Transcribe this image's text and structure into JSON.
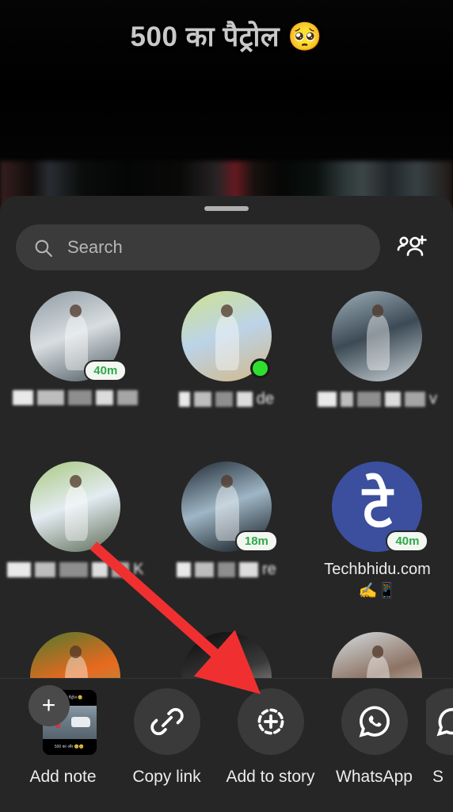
{
  "video": {
    "caption": "500 का पैट्रोल 🥺",
    "caption_color": "#c9c9c9"
  },
  "sheet": {
    "handle_name": "drag-handle"
  },
  "search": {
    "placeholder": "Search",
    "value": "",
    "icon": "search-icon",
    "add_people_icon": "add-people-icon"
  },
  "contacts": [
    {
      "name": "",
      "name_redacted": true,
      "redacted_blocks": [
        26,
        34,
        30,
        22,
        26
      ],
      "avatar_type": "photo",
      "avatar_desc": "man standing beside white suv",
      "avatar_colors": [
        "#8d9aa2",
        "#d8dde0",
        "#4d5a61"
      ],
      "time_badge": "40m",
      "online": false
    },
    {
      "name": "de",
      "name_redacted": true,
      "redacted_blocks": [
        14,
        22,
        22,
        20
      ],
      "avatar_type": "photo",
      "avatar_desc": "man in blue shirt in field",
      "avatar_colors": [
        "#cfe38f",
        "#bcd3e8",
        "#d2b98a"
      ],
      "time_badge": "",
      "online": true
    },
    {
      "name": "v",
      "name_redacted": true,
      "redacted_blocks": [
        24,
        16,
        30,
        20,
        26
      ],
      "avatar_type": "photo",
      "avatar_desc": "man sitting on motorcycle",
      "avatar_colors": [
        "#9fb0bb",
        "#3c4a55",
        "#cbd4d8"
      ],
      "time_badge": "",
      "online": false
    },
    {
      "name": "K",
      "name_redacted": true,
      "redacted_blocks": [
        30,
        26,
        36,
        20,
        22
      ],
      "avatar_type": "photo",
      "avatar_desc": "man in white shirt on road",
      "avatar_colors": [
        "#a9c77f",
        "#e3ecf2",
        "#5d6b55"
      ],
      "time_badge": "",
      "online": false
    },
    {
      "name": "re",
      "name_redacted": true,
      "redacted_blocks": [
        18,
        24,
        22,
        24
      ],
      "avatar_type": "photo",
      "avatar_desc": "dark devotional poster with text",
      "avatar_colors": [
        "#1d2730",
        "#9fb6c6",
        "#0c1319"
      ],
      "time_badge": "18m",
      "online": false
    },
    {
      "name": "Techbhidu.com",
      "name_redacted": false,
      "emoji": "✍️📱",
      "avatar_type": "logo",
      "avatar_initial": "टे",
      "avatar_bg": "#3b4f9e",
      "time_badge": "40m",
      "online": false
    },
    {
      "name": "",
      "name_redacted": true,
      "redacted_blocks": [],
      "avatar_type": "photo",
      "avatar_desc": "two men with orange turbans in greenery",
      "avatar_colors": [
        "#4f7a2e",
        "#e8691f",
        "#89a85c"
      ],
      "time_badge": "",
      "online": false
    },
    {
      "name": "",
      "name_redacted": true,
      "redacted_blocks": [],
      "avatar_type": "photo",
      "avatar_desc": "person in dark clothing on black background",
      "avatar_colors": [
        "#0a0a0a",
        "#3a3a3a",
        "#d9d2c8"
      ],
      "time_badge": "",
      "online": false
    },
    {
      "name": "",
      "name_redacted": true,
      "redacted_blocks": [],
      "avatar_type": "photo",
      "avatar_desc": "man in white shirt light background",
      "avatar_colors": [
        "#d6dde2",
        "#8c7363",
        "#f0f2f4"
      ],
      "time_badge": "",
      "online": false
    }
  ],
  "share_actions": [
    {
      "label": "Add note",
      "icon": "add-note-thumbnail",
      "note_text_top": "500 का पैट्रोल 🥺",
      "note_text_bottom": "500 का और 🥺🥺"
    },
    {
      "label": "Copy link",
      "icon": "link-icon"
    },
    {
      "label": "Add to story",
      "icon": "add-to-story-icon"
    },
    {
      "label": "WhatsApp",
      "icon": "whatsapp-icon"
    },
    {
      "label": "S",
      "icon": "sms-icon"
    }
  ],
  "annotation": {
    "arrow_color": "#f03030",
    "arrow_from": "contact-4-avatar",
    "arrow_to": "add-to-story-button"
  },
  "colors": {
    "sheet_bg": "#262626",
    "search_bg": "#3b3b3b",
    "badge_text": "#2fa84a",
    "online_dot": "#2ee02e",
    "accent_arrow": "#f03030"
  }
}
